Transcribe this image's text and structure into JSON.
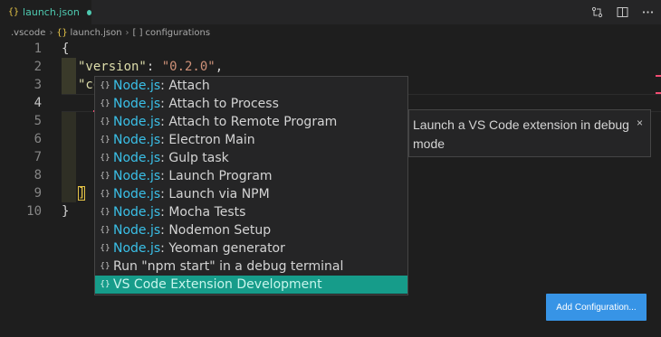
{
  "tab": {
    "icon": "{}",
    "label": "launch.json"
  },
  "title_actions": [
    "compare-changes-icon",
    "split-editor-icon",
    "more-icon"
  ],
  "breadcrumb": [
    {
      "icon": "",
      "label": ".vscode"
    },
    {
      "icon": "{}",
      "label": "launch.json"
    },
    {
      "icon": "[ ]",
      "label": "configurations"
    }
  ],
  "lines": [
    {
      "num": "1",
      "text": "{"
    },
    {
      "num": "2",
      "key": "\"version\"",
      "colon": ": ",
      "value": "\"0.2.0\"",
      "tail": ","
    },
    {
      "num": "3",
      "key": "\"configurations\"",
      "colon": ": ",
      "bracket": "["
    },
    {
      "num": "4"
    },
    {
      "num": "5"
    },
    {
      "num": "6"
    },
    {
      "num": "7"
    },
    {
      "num": "8"
    },
    {
      "num": "9",
      "bracket": "]"
    },
    {
      "num": "10",
      "text": "}"
    }
  ],
  "suggestions": [
    {
      "icon": "{}",
      "match": "Node.js",
      "rest": ": Attach"
    },
    {
      "icon": "{}",
      "match": "Node.js",
      "rest": ": Attach to Process"
    },
    {
      "icon": "{}",
      "match": "Node.js",
      "rest": ": Attach to Remote Program"
    },
    {
      "icon": "{}",
      "match": "Node.js",
      "rest": ": Electron Main"
    },
    {
      "icon": "{}",
      "match": "Node.js",
      "rest": ": Gulp task"
    },
    {
      "icon": "{}",
      "match": "Node.js",
      "rest": ": Launch Program"
    },
    {
      "icon": "{}",
      "match": "Node.js",
      "rest": ": Launch via NPM"
    },
    {
      "icon": "{}",
      "match": "Node.js",
      "rest": ": Mocha Tests"
    },
    {
      "icon": "{}",
      "match": "Node.js",
      "rest": ": Nodemon Setup"
    },
    {
      "icon": "{}",
      "match": "Node.js",
      "rest": ": Yeoman generator"
    },
    {
      "icon": "{}",
      "match": "",
      "rest": "Run \"npm start\" in a debug terminal"
    },
    {
      "icon": "{}",
      "match": "",
      "rest": "VS Code Extension Development"
    }
  ],
  "selected_index": 11,
  "doc": {
    "text": "Launch a VS Code extension in debug mode",
    "close": "×"
  },
  "add_button": "Add Configuration...",
  "colors": {
    "accent": "#4ec9b0",
    "selection": "#169c8a",
    "button": "#3794e6",
    "cursor": "#f24c72"
  }
}
